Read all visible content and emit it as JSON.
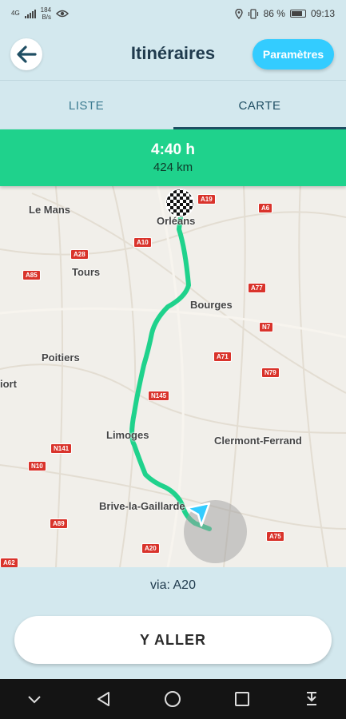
{
  "status_bar": {
    "network": "4G",
    "speed_value": "184",
    "speed_unit": "B/s",
    "battery": "86 %",
    "time": "09:13",
    "icons": [
      "signal-icon",
      "eye-icon",
      "location-icon",
      "vibrate-icon",
      "battery-icon"
    ]
  },
  "header": {
    "title": "Itinéraires",
    "settings_label": "Paramètres",
    "back_icon": "arrow-left-icon"
  },
  "tabs": [
    {
      "label": "LISTE",
      "active": false
    },
    {
      "label": "CARTE",
      "active": true
    }
  ],
  "route_summary": {
    "duration": "4:40 h",
    "distance": "424 km"
  },
  "map": {
    "cities": [
      "Le Mans",
      "Orléans",
      "Tours",
      "Bourges",
      "Poitiers",
      "iort",
      "Limoges",
      "Clermont-Ferrand",
      "Brive-la-Gaillarde"
    ],
    "roads": [
      "A19",
      "A6",
      "A10",
      "A28",
      "A85",
      "A77",
      "N7",
      "A71",
      "N79",
      "N145",
      "N141",
      "N10",
      "A89",
      "A20",
      "A75",
      "A62"
    ],
    "route_color": "#1fd28c",
    "destination_icon": "checkered-flag-icon",
    "origin_icon": "navigation-arrow-icon"
  },
  "via": "via: A20",
  "go_button": "Y ALLER",
  "colors": {
    "accent": "#33ccff",
    "summary_bg": "#1fd28c",
    "background": "#d3e8ee",
    "title": "#1f3a4d"
  },
  "nav_bar": {
    "icons": [
      "chevron-down-icon",
      "back-triangle-icon",
      "home-circle-icon",
      "recents-square-icon",
      "notification-pull-icon"
    ]
  }
}
